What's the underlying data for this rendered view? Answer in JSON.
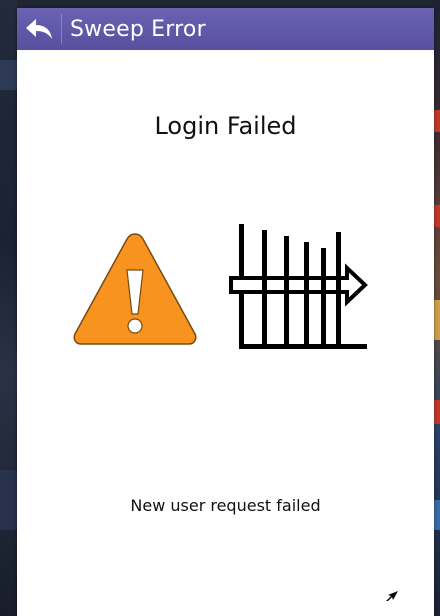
{
  "titlebar": {
    "title": "Sweep Error",
    "back_icon": "back-arrow-icon"
  },
  "dialog": {
    "heading": "Login Failed",
    "message": "New user request failed",
    "icons": [
      "warning-icon",
      "sweep-fence-icon"
    ]
  },
  "colors": {
    "titlebar": "#5a52a3",
    "warning_fill": "#f7931e",
    "background": "#ffffff",
    "text": "#111111"
  }
}
